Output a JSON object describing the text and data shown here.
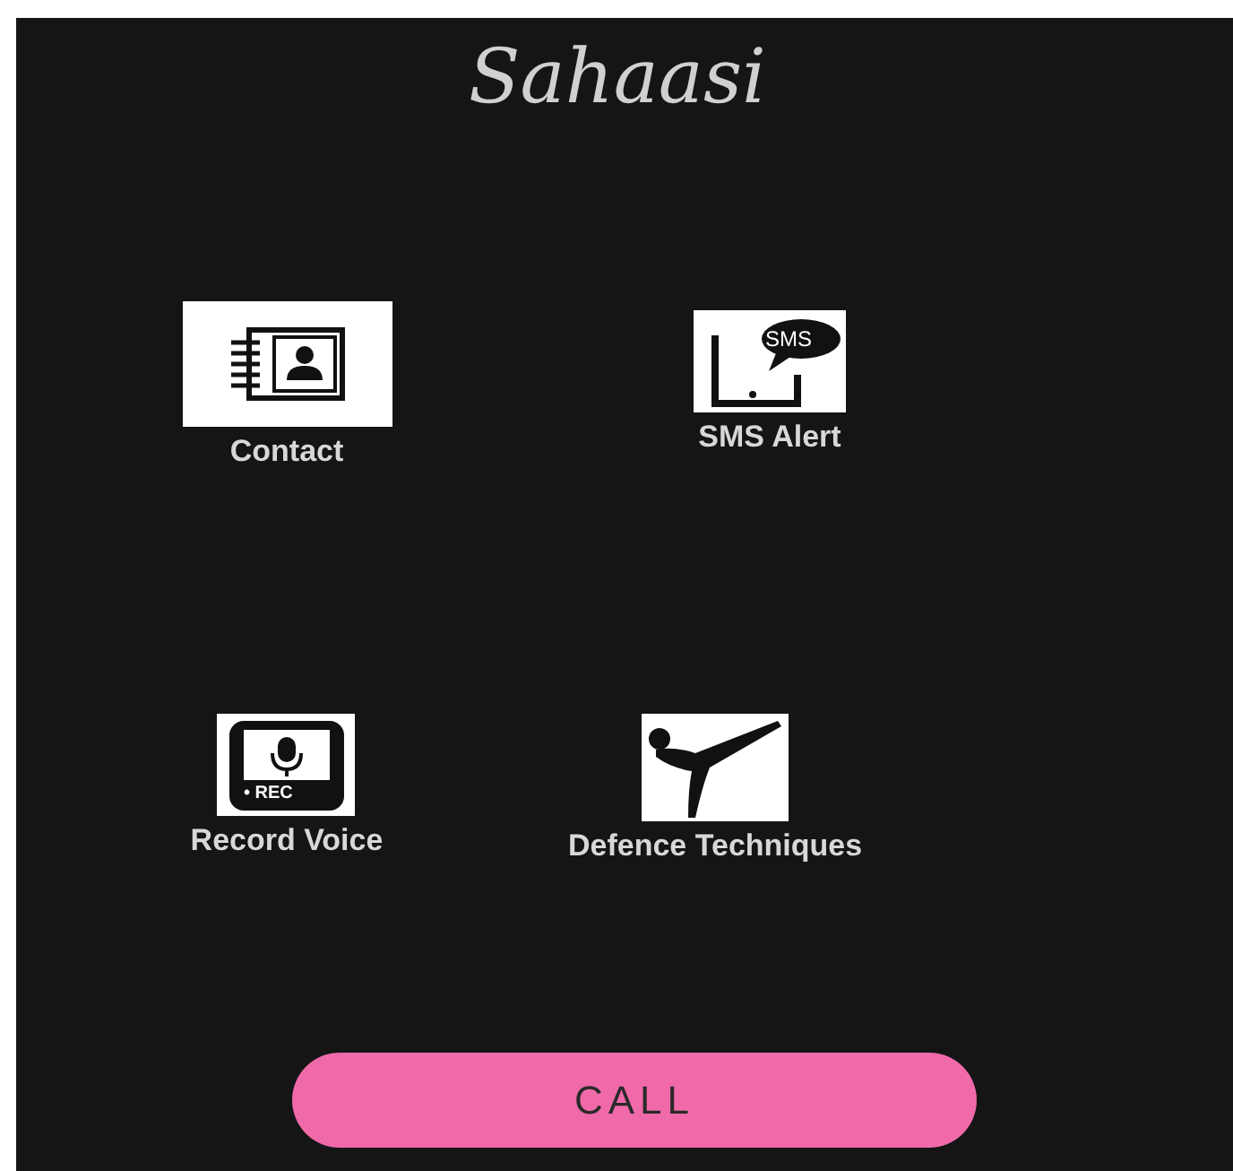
{
  "app": {
    "title": "Sahaasi"
  },
  "tiles": [
    {
      "kind": "contact",
      "label": "Contact"
    },
    {
      "kind": "sms",
      "label": "SMS Alert",
      "badge": "SMS"
    },
    {
      "kind": "record",
      "label": "Record Voice",
      "badge": "• REC"
    },
    {
      "kind": "defence",
      "label": "Defence Techniques"
    }
  ],
  "call_button": {
    "label": "CALL"
  }
}
